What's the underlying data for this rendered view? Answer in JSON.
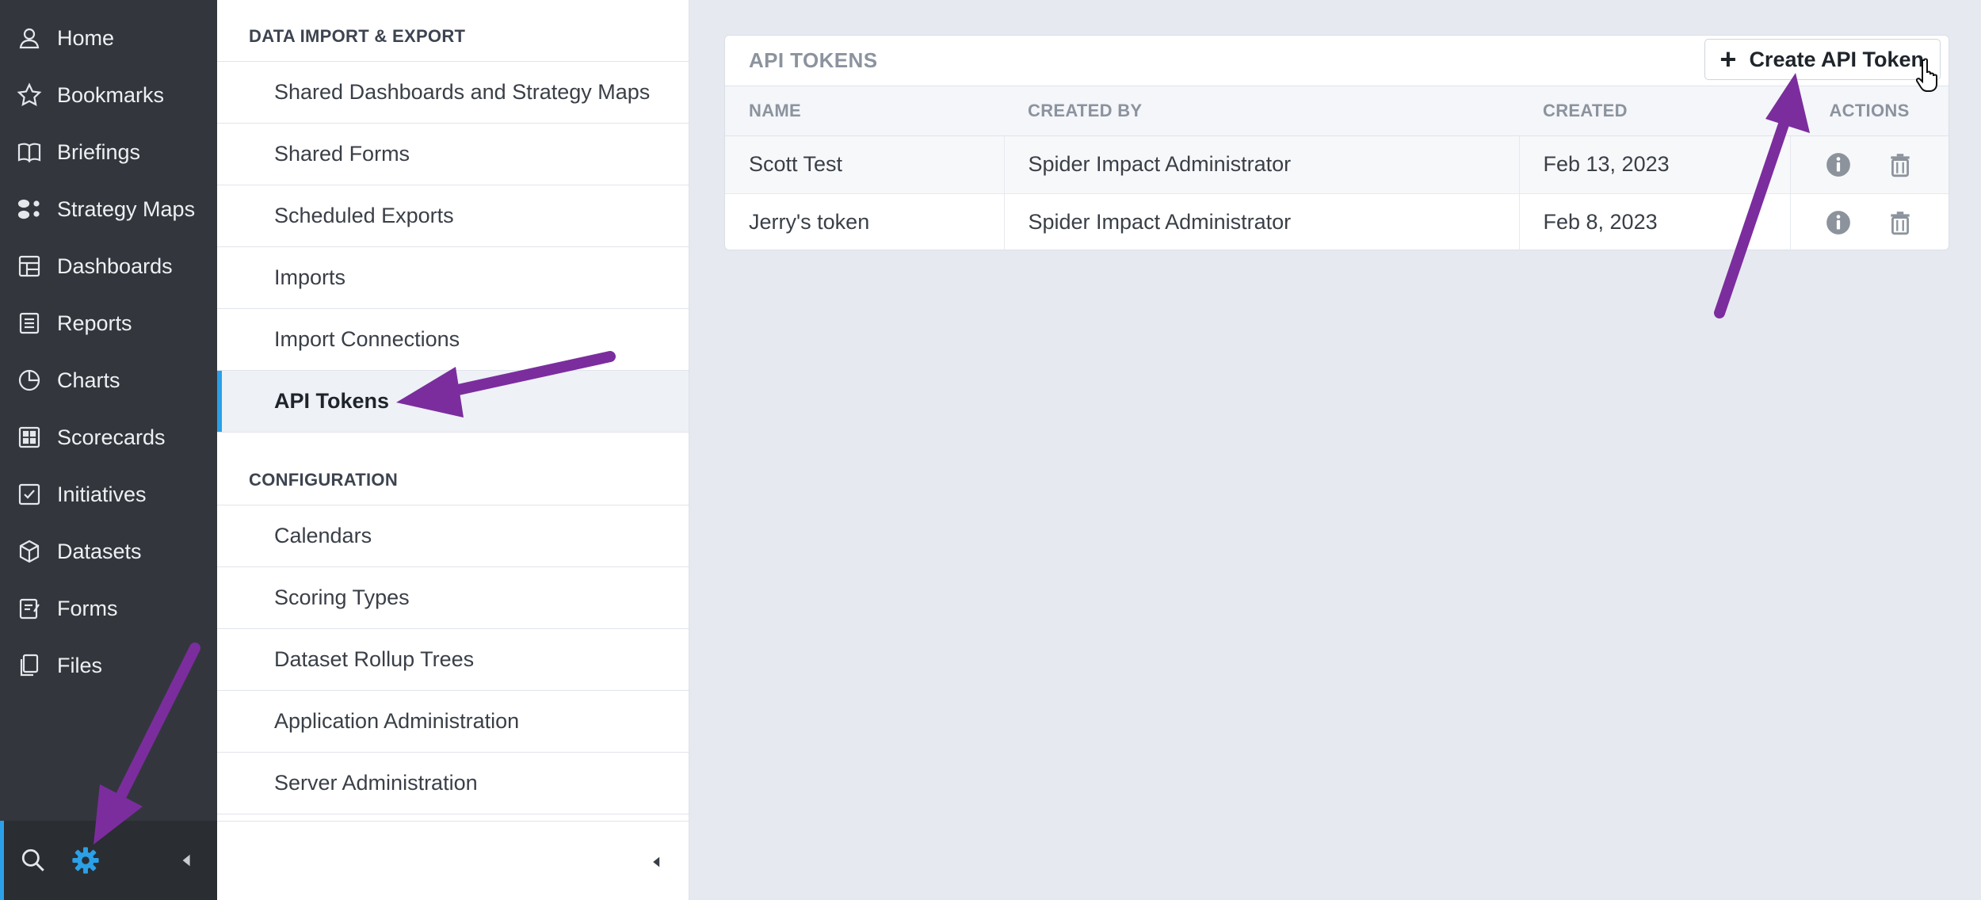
{
  "nav": {
    "items": [
      {
        "label": "Home",
        "icon": "user-icon"
      },
      {
        "label": "Bookmarks",
        "icon": "star-icon"
      },
      {
        "label": "Briefings",
        "icon": "book-icon"
      },
      {
        "label": "Strategy Maps",
        "icon": "strategy-map-icon"
      },
      {
        "label": "Dashboards",
        "icon": "dashboard-icon"
      },
      {
        "label": "Reports",
        "icon": "report-icon"
      },
      {
        "label": "Charts",
        "icon": "pie-chart-icon"
      },
      {
        "label": "Scorecards",
        "icon": "scorecard-icon"
      },
      {
        "label": "Initiatives",
        "icon": "checkbox-icon"
      },
      {
        "label": "Datasets",
        "icon": "cube-icon"
      },
      {
        "label": "Forms",
        "icon": "form-icon"
      },
      {
        "label": "Files",
        "icon": "files-icon"
      }
    ],
    "accent": "#2aa0e8"
  },
  "settings": {
    "section1": "DATA IMPORT & EXPORT",
    "items1": [
      "Shared Dashboards and Strategy Maps",
      "Shared Forms",
      "Scheduled Exports",
      "Imports",
      "Import Connections",
      "API Tokens"
    ],
    "section2": "CONFIGURATION",
    "items2": [
      "Calendars",
      "Scoring Types",
      "Dataset Rollup Trees",
      "Application Administration",
      "Server Administration"
    ],
    "active": "API Tokens"
  },
  "tokens": {
    "title": "API TOKENS",
    "create_label": "Create API Token",
    "columns": [
      "NAME",
      "CREATED BY",
      "CREATED",
      "ACTIONS"
    ],
    "rows": [
      {
        "name": "Scott Test",
        "created_by": "Spider Impact Administrator",
        "created": "Feb 13, 2023"
      },
      {
        "name": "Jerry's token",
        "created_by": "Spider Impact Administrator",
        "created": "Feb 8, 2023"
      }
    ]
  },
  "annotation_color": "#7b2d9e"
}
